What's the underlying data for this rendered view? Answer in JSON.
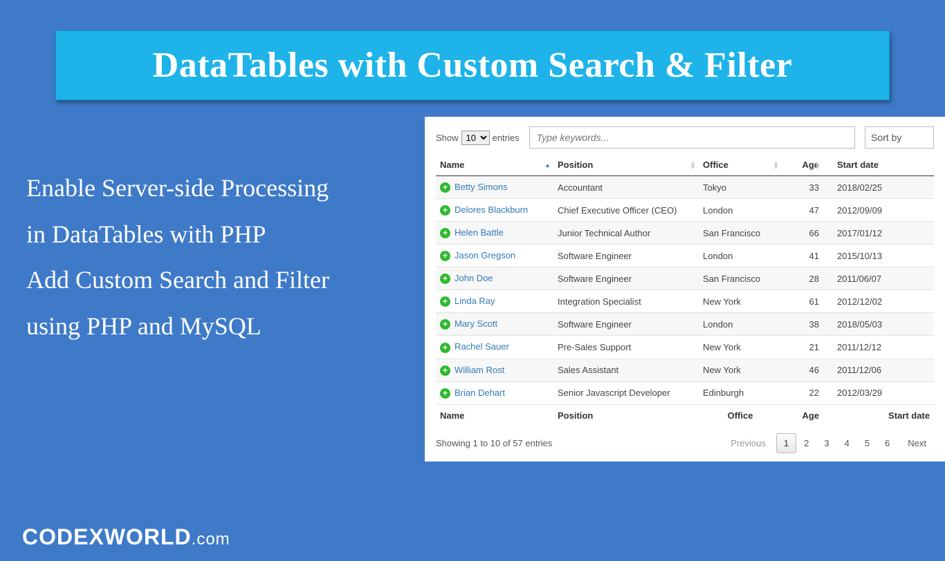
{
  "banner": {
    "title": "DataTables with Custom Search & Filter"
  },
  "left": {
    "line1": "Enable Server-side Processing",
    "line2": "in DataTables with PHP",
    "line3": "Add Custom Search and Filter",
    "line4": "using PHP and MySQL"
  },
  "table": {
    "show_label_pre": "Show",
    "show_value": "10",
    "show_label_post": "entries",
    "search_placeholder": "Type keywords...",
    "sort_label": "Sort by",
    "columns": [
      "Name",
      "Position",
      "Office",
      "Age",
      "Start date"
    ],
    "rows": [
      {
        "name": "Betty Simons",
        "position": "Accountant",
        "office": "Tokyo",
        "age": "33",
        "start": "2018/02/25"
      },
      {
        "name": "Delores Blackburn",
        "position": "Chief Executive Officer (CEO)",
        "office": "London",
        "age": "47",
        "start": "2012/09/09"
      },
      {
        "name": "Helen Battle",
        "position": "Junior Technical Author",
        "office": "San Francisco",
        "age": "66",
        "start": "2017/01/12"
      },
      {
        "name": "Jason Gregson",
        "position": "Software Engineer",
        "office": "London",
        "age": "41",
        "start": "2015/10/13"
      },
      {
        "name": "John Doe",
        "position": "Software Engineer",
        "office": "San Francisco",
        "age": "28",
        "start": "2011/06/07"
      },
      {
        "name": "Linda Ray",
        "position": "Integration Specialist",
        "office": "New York",
        "age": "61",
        "start": "2012/12/02"
      },
      {
        "name": "Mary Scott",
        "position": "Software Engineer",
        "office": "London",
        "age": "38",
        "start": "2018/05/03"
      },
      {
        "name": "Rachel Sauer",
        "position": "Pre-Sales Support",
        "office": "New York",
        "age": "21",
        "start": "2011/12/12"
      },
      {
        "name": "William Rost",
        "position": "Sales Assistant",
        "office": "New York",
        "age": "46",
        "start": "2011/12/06"
      },
      {
        "name": "Brian Dehart",
        "position": "Senior Javascript Developer",
        "office": "Edinburgh",
        "age": "22",
        "start": "2012/03/29"
      }
    ],
    "info": "Showing 1 to 10 of 57 entries",
    "pagination": {
      "previous": "Previous",
      "pages": [
        "1",
        "2",
        "3",
        "4",
        "5",
        "6"
      ],
      "active": "1",
      "next": "Next"
    }
  },
  "logo": {
    "brand": "CODEXWORLD",
    "suffix": ".com"
  }
}
